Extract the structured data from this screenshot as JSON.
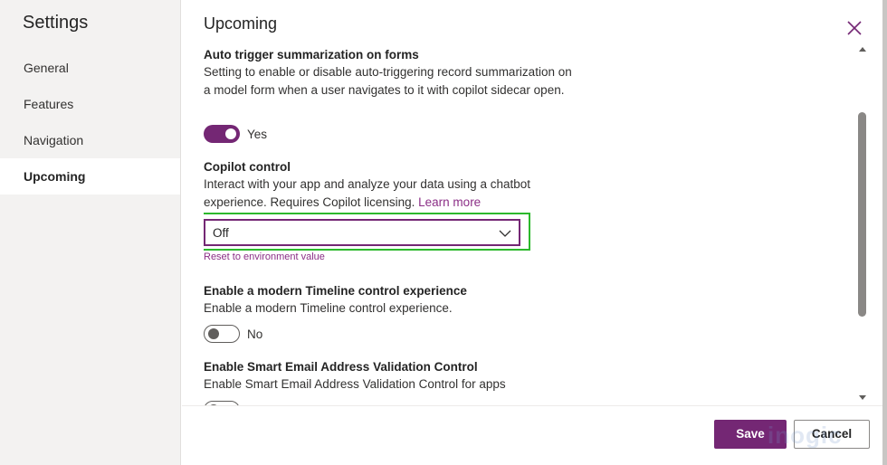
{
  "sidebar": {
    "title": "Settings",
    "items": [
      {
        "label": "General",
        "selected": false
      },
      {
        "label": "Features",
        "selected": false
      },
      {
        "label": "Navigation",
        "selected": false
      },
      {
        "label": "Upcoming",
        "selected": true
      }
    ]
  },
  "main": {
    "title": "Upcoming",
    "close_icon": "close-icon"
  },
  "settings": {
    "auto_summarize": {
      "title": "Auto trigger summarization on forms",
      "description": "Setting to enable or disable auto-triggering record summarization on a model form when a user navigates to it with copilot sidecar open.",
      "toggle_state": true,
      "toggle_label": "Yes"
    },
    "copilot_control": {
      "title": "Copilot control",
      "description": "Interact with your app and analyze your data using a chatbot experience. Requires Copilot licensing.",
      "link_text": "Learn more",
      "dropdown_value": "Off",
      "reset_text": "Reset to environment value"
    },
    "timeline": {
      "title": "Enable a modern Timeline control experience",
      "description": "Enable a modern Timeline control experience.",
      "toggle_state": false,
      "toggle_label": "No"
    },
    "email_validation": {
      "title": "Enable Smart Email Address Validation Control",
      "description": "Enable Smart Email Address Validation Control for apps"
    }
  },
  "footer": {
    "save_label": "Save",
    "cancel_label": "Cancel"
  },
  "watermark": "inogic",
  "colors": {
    "accent": "#742774",
    "link": "#8b2e86",
    "highlight": "#2cb82c",
    "sidebar_bg": "#f3f2f1"
  }
}
